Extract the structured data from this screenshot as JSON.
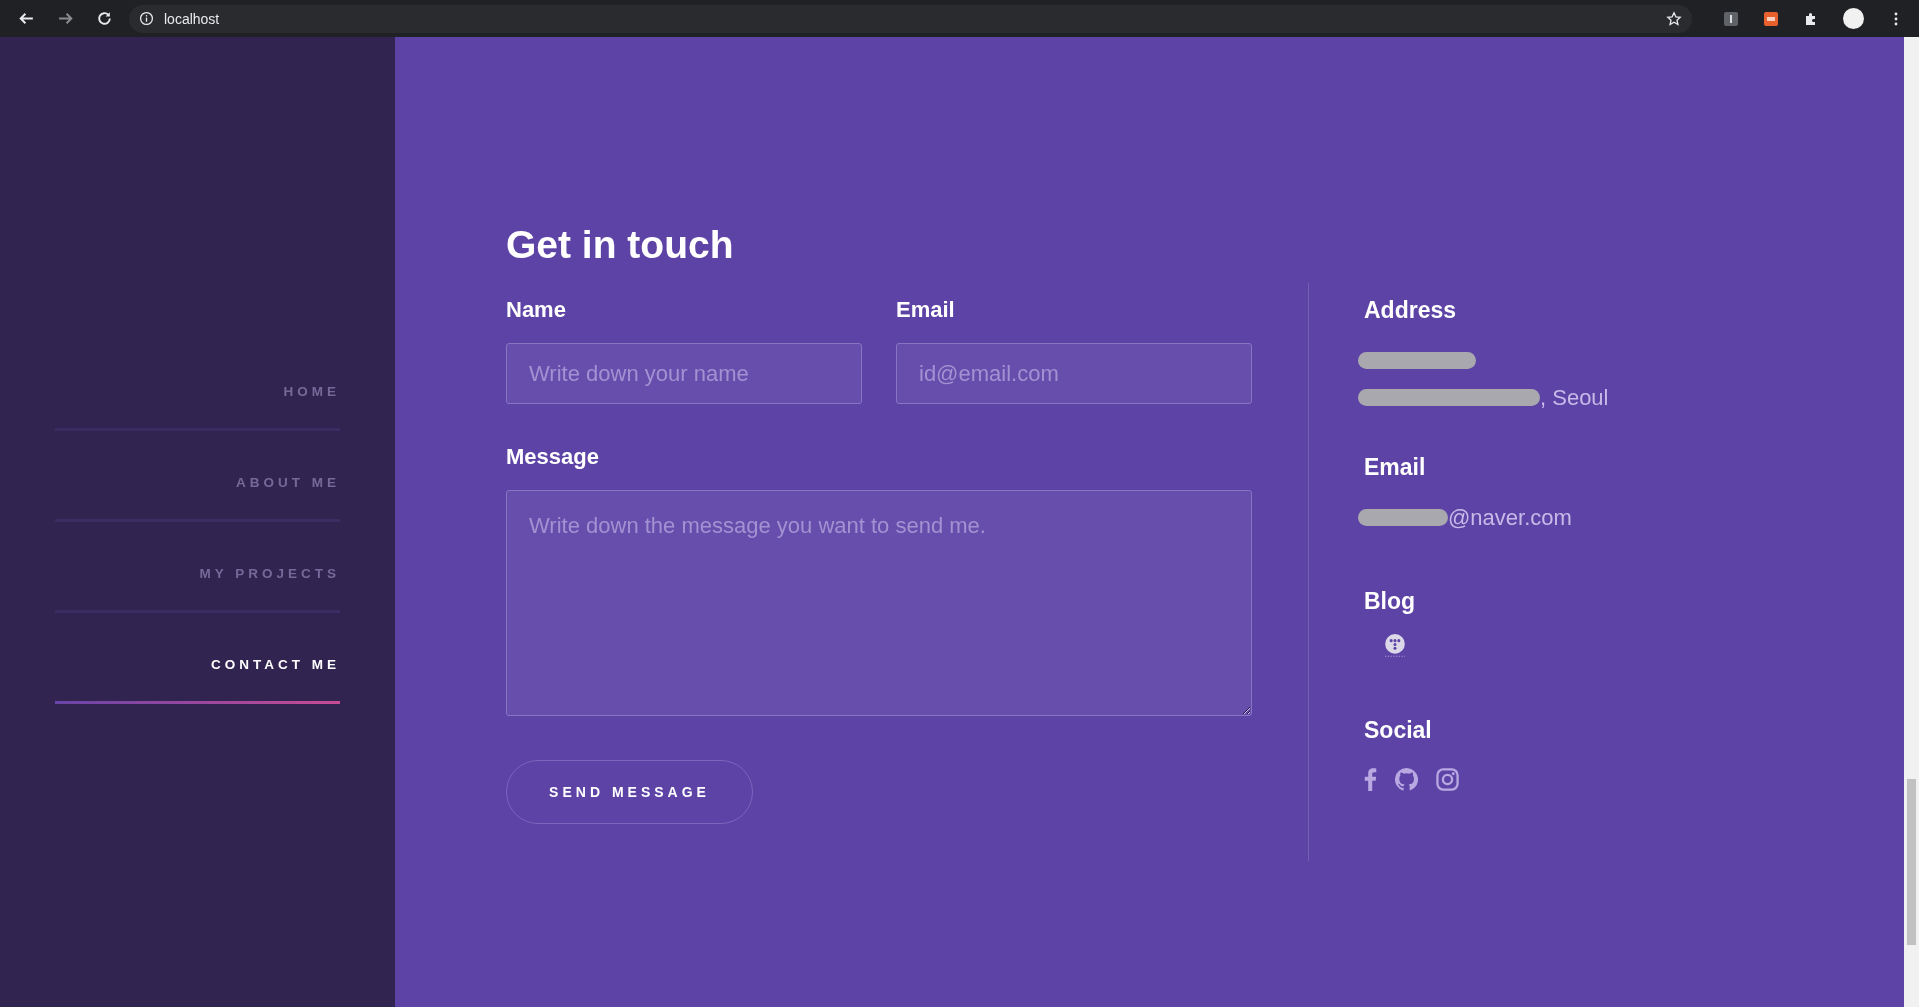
{
  "browser": {
    "url": "localhost"
  },
  "nav": [
    {
      "label": "HOME",
      "selected": false
    },
    {
      "label": "ABOUT ME",
      "selected": false
    },
    {
      "label": "MY PROJECTS",
      "selected": false
    },
    {
      "label": "CONTACT ME",
      "selected": true
    }
  ],
  "form": {
    "title": "Get in touch",
    "fields": [
      {
        "label": "Name",
        "placeholder": "Write down your name",
        "kind": "input"
      },
      {
        "label": "Email",
        "placeholder": "id@email.com",
        "kind": "input"
      },
      {
        "label": "Message",
        "placeholder": "Write down the message you want to send me.",
        "kind": "textarea"
      }
    ],
    "submit": "SEND MESSAGE"
  },
  "info": {
    "address": {
      "heading": "Address",
      "lines": [
        {
          "redacted": true
        },
        {
          "redacted": true,
          "text": ", Seoul"
        }
      ]
    },
    "email": {
      "heading": "Email",
      "redacted": true,
      "text": "@naver.com"
    },
    "blog": {
      "heading": "Blog"
    },
    "social": {
      "heading": "Social",
      "links": [
        {
          "kind": "facebook"
        },
        {
          "kind": "github"
        },
        {
          "kind": "instagram"
        }
      ]
    }
  }
}
